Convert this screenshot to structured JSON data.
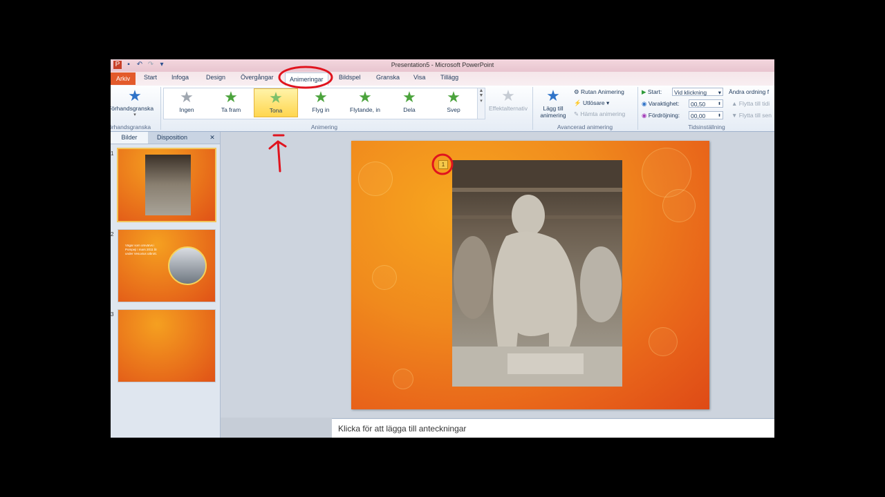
{
  "window": {
    "title": "Presentation5 - Microsoft PowerPoint"
  },
  "tabs": {
    "file": "Arkiv",
    "items": [
      "Start",
      "Infoga",
      "Design",
      "Övergångar",
      "Animeringar",
      "Bildspel",
      "Granska",
      "Visa",
      "Tillägg"
    ],
    "active": "Animeringar"
  },
  "ribbon": {
    "preview": {
      "label": "Förhandsgranska",
      "group": "Förhandsgranska"
    },
    "gallery": {
      "items": [
        "Ingen",
        "Ta fram",
        "Tona",
        "Flyg in",
        "Flytande, in",
        "Dela",
        "Svep"
      ],
      "selected": "Tona",
      "group": "Animering"
    },
    "effect_options": "Effektalternativ",
    "advanced": {
      "add_animation": "Lägg till animering",
      "pane": "Rutan Animering",
      "trigger": "Utlösare",
      "painter": "Hämta animering",
      "group": "Avancerad animering"
    },
    "timing": {
      "start_label": "Start:",
      "start_value": "Vid klickning",
      "duration_label": "Varaktighet:",
      "duration_value": "00,50",
      "delay_label": "Fördröjning:",
      "delay_value": "00,00",
      "reorder_title": "Ändra ordning f",
      "move_earlier": "Flytta till tidi",
      "move_later": "Flytta till sen",
      "group": "Tidsinställning"
    }
  },
  "left_pane": {
    "tabs": [
      "Bilder",
      "Disposition"
    ],
    "close": "✕",
    "slides": [
      {
        "num": "1",
        "text": ""
      },
      {
        "num": "2",
        "text": "Vägar som omvärvs i Pompeji i mars 2011 år under Vesuvius utbrott."
      },
      {
        "num": "3",
        "text": ""
      }
    ]
  },
  "slide": {
    "anim_tag": "1"
  },
  "notes": {
    "placeholder": "Klicka för att lägga till anteckningar"
  },
  "colors": {
    "accent_orange": "#ec7d1c",
    "file_tab": "#e35a2b",
    "annotation_red": "#e0141e"
  }
}
